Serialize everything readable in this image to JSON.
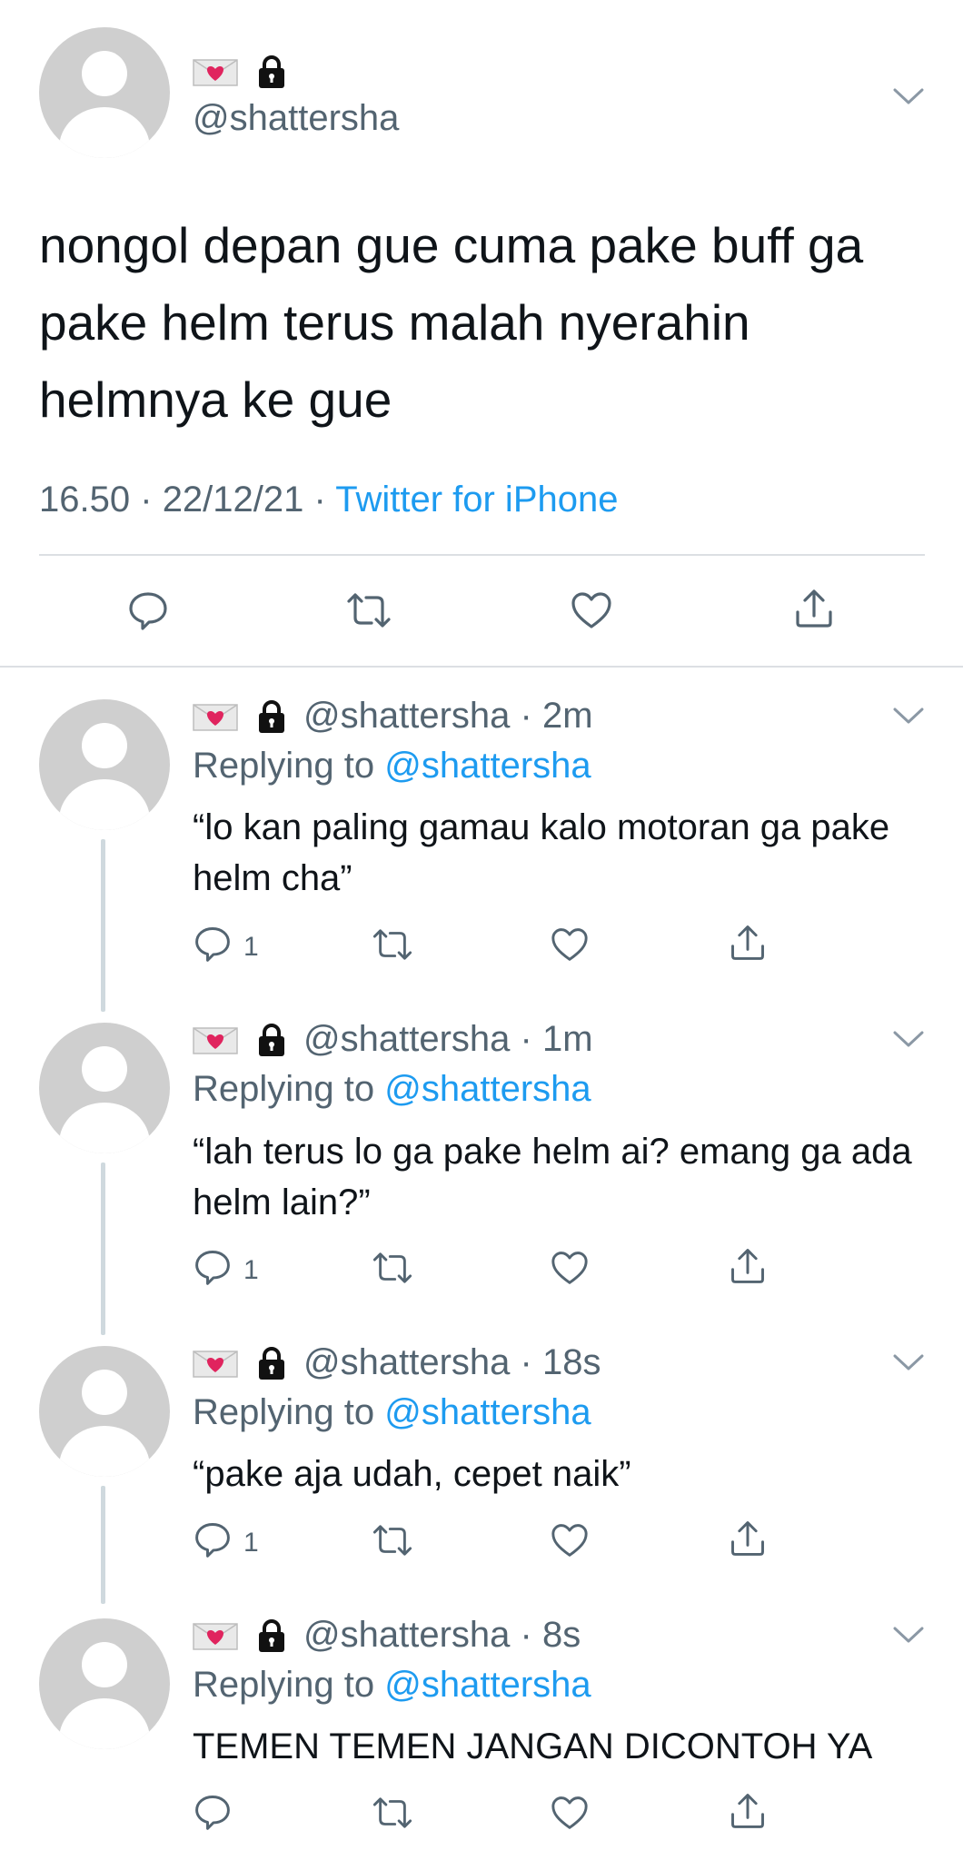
{
  "main_tweet": {
    "handle": "@shattersha",
    "text": "nongol depan gue cuma pake buff ga pake helm terus malah nyerahin helmnya ke gue",
    "time": "16.50",
    "date": "22/12/21",
    "app": "Twitter for iPhone"
  },
  "separator": "·",
  "replies": [
    {
      "handle": "@shattersha",
      "age": "2m",
      "replying_label": "Replying to",
      "replying_to": "@shattersha",
      "text": "“lo kan paling gamau kalo motoran ga pake helm cha”",
      "reply_count": "1"
    },
    {
      "handle": "@shattersha",
      "age": "1m",
      "replying_label": "Replying to",
      "replying_to": "@shattersha",
      "text": "“lah terus lo ga pake helm ai? emang ga ada helm lain?”",
      "reply_count": "1"
    },
    {
      "handle": "@shattersha",
      "age": "18s",
      "replying_label": "Replying to",
      "replying_to": "@shattersha",
      "text": "“pake aja udah, cepet naik”",
      "reply_count": "1"
    },
    {
      "handle": "@shattersha",
      "age": "8s",
      "replying_label": "Replying to",
      "replying_to": "@shattersha",
      "text": "TEMEN TEMEN JANGAN DICONTOH YA",
      "reply_count": ""
    }
  ],
  "colors": {
    "accent": "#1d9bf0",
    "secondary_text": "#536471",
    "avatar": "#cfcfcf",
    "heart": "#e0245e"
  }
}
